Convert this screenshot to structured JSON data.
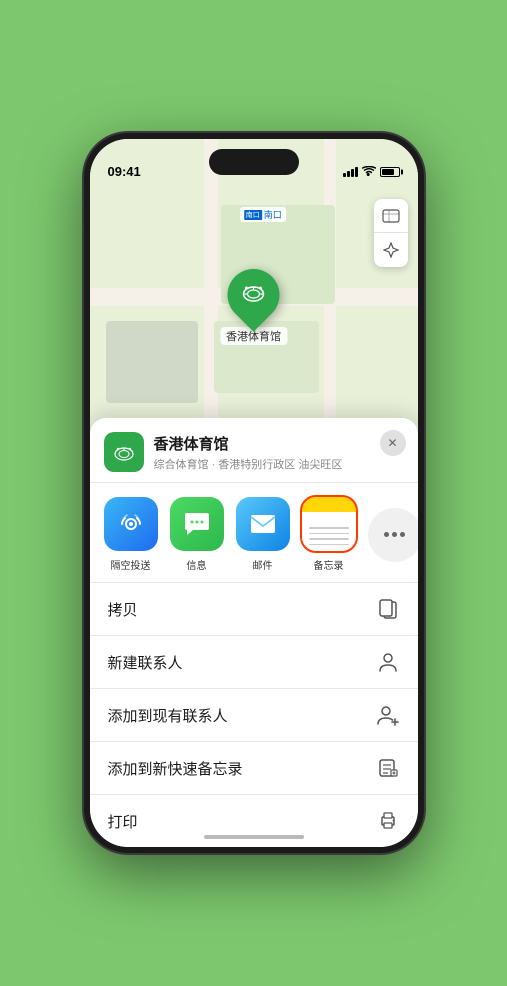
{
  "status_bar": {
    "time": "09:41",
    "navigation_arrow": "▶"
  },
  "map": {
    "south_gate_prefix": "南口",
    "south_gate_box_label": "南口",
    "map_type_icon": "🗺",
    "location_icon": "➤",
    "venue_name_pin": "香港体育馆",
    "stadium_emoji": "🏟"
  },
  "bottom_sheet": {
    "venue_icon_emoji": "🏟",
    "venue_name": "香港体育馆",
    "venue_subtitle": "综合体育馆 · 香港特别行政区 油尖旺区",
    "close_label": "✕"
  },
  "share_items": [
    {
      "label": "隔空投送",
      "type": "airdrop",
      "emoji": "📶"
    },
    {
      "label": "信息",
      "type": "message",
      "emoji": "💬"
    },
    {
      "label": "邮件",
      "type": "mail",
      "emoji": "✉️"
    },
    {
      "label": "备忘录",
      "type": "notes",
      "emoji": ""
    }
  ],
  "actions": [
    {
      "label": "拷贝",
      "icon": "copy"
    },
    {
      "label": "新建联系人",
      "icon": "person"
    },
    {
      "label": "添加到现有联系人",
      "icon": "person-add"
    },
    {
      "label": "添加到新快速备忘录",
      "icon": "note"
    },
    {
      "label": "打印",
      "icon": "printer"
    }
  ]
}
